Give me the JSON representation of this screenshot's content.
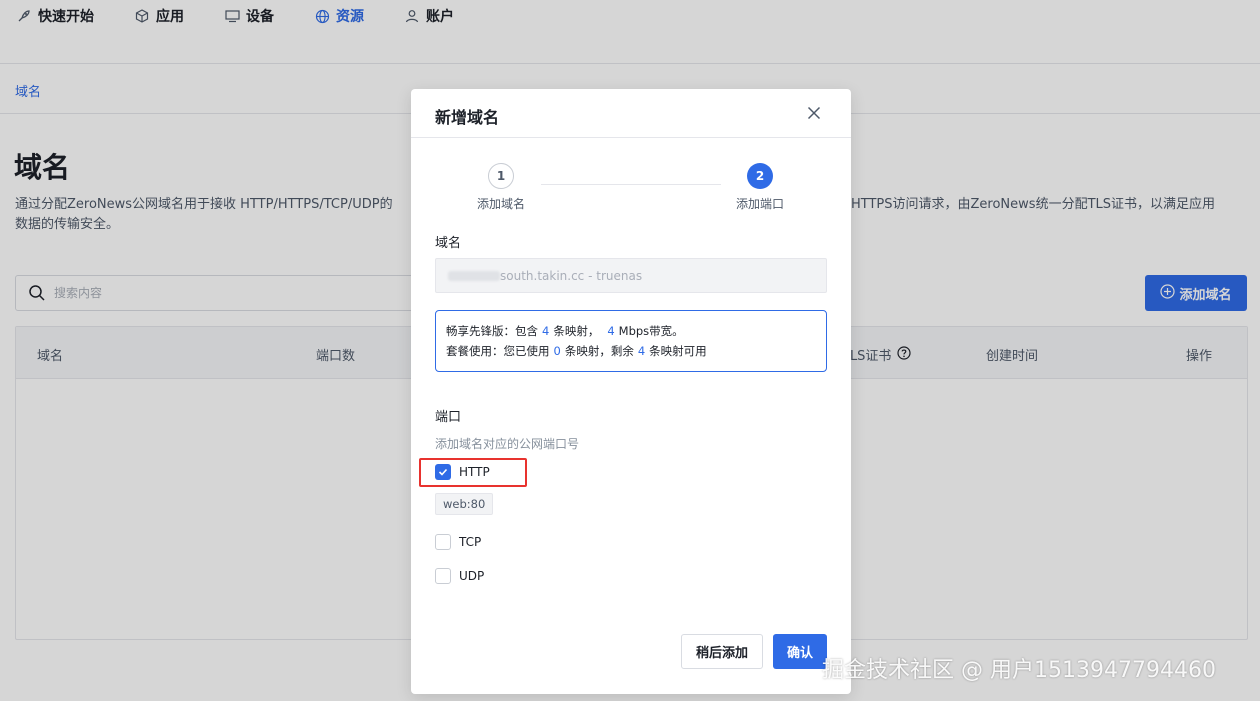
{
  "nav": {
    "items": [
      {
        "label": "快速开始",
        "icon": "rocket-icon"
      },
      {
        "label": "应用",
        "icon": "cube-icon"
      },
      {
        "label": "设备",
        "icon": "monitor-icon"
      },
      {
        "label": "资源",
        "icon": "globe-icon",
        "active": true
      },
      {
        "label": "账户",
        "icon": "user-icon"
      }
    ]
  },
  "subtab": {
    "label": "域名"
  },
  "page": {
    "title": "域名",
    "desc_left": "通过分配ZeroNews公网域名用于接收 HTTP/HTTPS/TCP/UDP的",
    "desc_right": "HTTPS访问请求，由ZeroNews统一分配TLS证书，以满足应用",
    "desc_line2": "数据的传输安全。"
  },
  "search": {
    "placeholder": "搜索内容"
  },
  "add_button": {
    "label": "添加域名"
  },
  "table": {
    "headers": {
      "domain": "域名",
      "ports": "端口数",
      "tls": "TLS证书",
      "created": "创建时间",
      "actions": "操作"
    }
  },
  "modal": {
    "title": "新增域名",
    "steps": [
      {
        "number": "1",
        "label": "添加域名"
      },
      {
        "number": "2",
        "label": "添加端口"
      }
    ],
    "domain_label": "域名",
    "domain_value": "south.takin.cc - truenas",
    "plan": {
      "line1_prefix": "畅享先锋版：包含",
      "line1_count": "4",
      "line1_mid": "条映射，",
      "line1_bw": "4",
      "line1_suffix": "Mbps带宽。",
      "line2_prefix": "套餐使用：您已使用",
      "line2_used": "0",
      "line2_mid": "条映射，剩余",
      "line2_left": "4",
      "line2_suffix": "条映射可用"
    },
    "port_label": "端口",
    "port_hint": "添加域名对应的公网端口号",
    "ports": [
      {
        "label": "HTTP",
        "checked": true
      },
      {
        "label": "TCP",
        "checked": false
      },
      {
        "label": "UDP",
        "checked": false
      }
    ],
    "http_tag": "web:80",
    "later_button": "稍后添加",
    "confirm_button": "确认"
  },
  "colors": {
    "accent": "#2f6be6",
    "highlight": "#e8322e"
  },
  "watermark": "掘金技术社区 @ 用户1513947794460"
}
